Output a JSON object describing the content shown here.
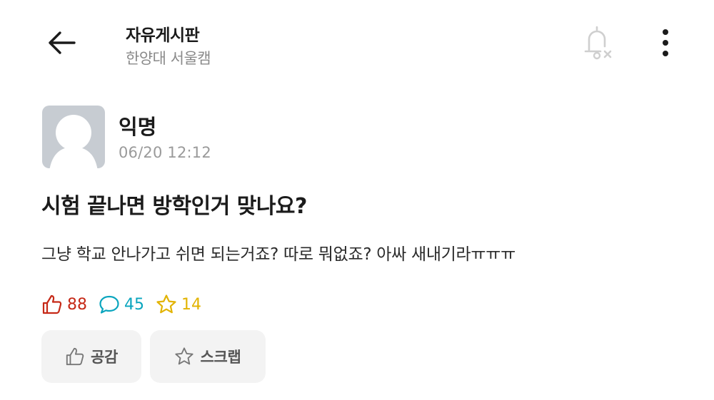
{
  "header": {
    "board_title": "자유게시판",
    "school": "한양대 서울캠",
    "icons": [
      "back-arrow-icon",
      "bell-off-icon",
      "more-vertical-icon"
    ]
  },
  "post": {
    "author": "익명",
    "time": "06/20 12:12",
    "title": "시험 끝나면 방학인거 맞나요?",
    "body": "그냥 학교 안나가고 쉬면 되는거죠? 따로 뭐없죠? 아싸 새내기라ㅠㅠㅠ"
  },
  "stats": {
    "likes": "88",
    "comments": "45",
    "scraps": "14",
    "colors": {
      "like": "#c62917",
      "comment": "#0aa5be",
      "scrap": "#e2b300"
    }
  },
  "actions": {
    "empathy_label": "공감",
    "scrap_label": "스크랩"
  }
}
